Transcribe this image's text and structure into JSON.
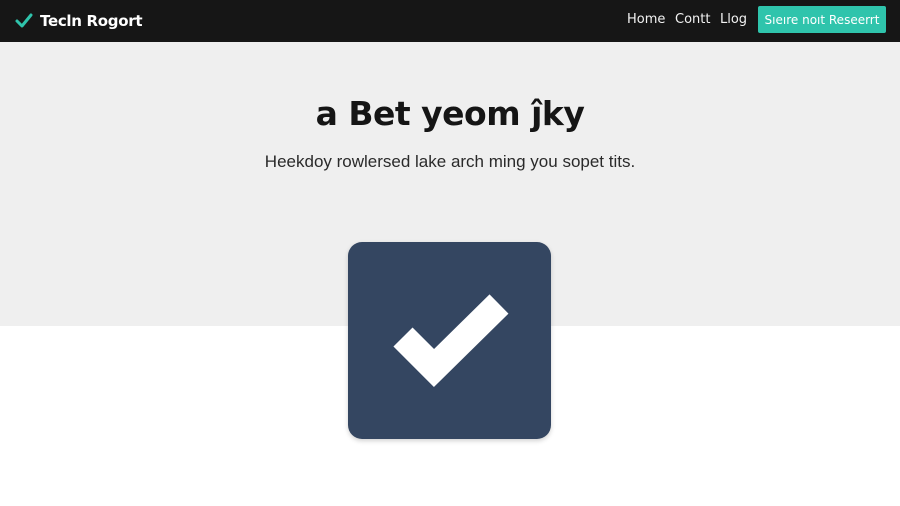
{
  "navbar": {
    "brand_name": "Tecln Rogort",
    "brand_icon": "checkmark-icon",
    "links": [
      {
        "label": "Home"
      },
      {
        "label": "Contt"
      },
      {
        "label": "Llog"
      }
    ],
    "cta_label": "Sıeıre noıt Reseerrt"
  },
  "hero": {
    "title": "a Bet yeom ĵky",
    "subtitle": "Heekdoy rowlersed lake arch ming you sopet tits."
  },
  "feature_icon": "checkmark-icon",
  "colors": {
    "navbar_bg": "#161616",
    "accent": "#2fc4ac",
    "hero_bg": "#efefef",
    "tile_bg": "#344661"
  }
}
